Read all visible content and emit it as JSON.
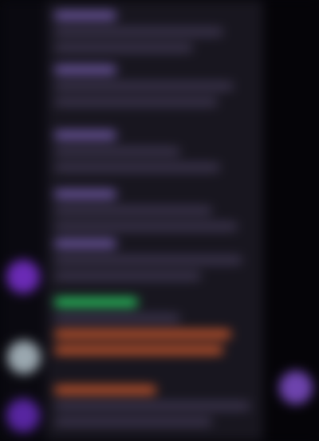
{
  "theme": {
    "background": "#06060a",
    "chat_surface": "#18161f",
    "name_color": "#6e58a2",
    "text_color": "#3e3650",
    "green_highlight": "#29d965",
    "orange_highlight": "#d45b2d",
    "avatar_purple": "#6a2ab5",
    "avatar_gray": "#9aa7af",
    "avatar_violet": "#5725a0",
    "right_bubble": "#6d43ad"
  },
  "chat": {
    "visible_text": ""
  },
  "icons": {
    "left_avatars": [
      "avatar-icon",
      "avatar-icon",
      "avatar-icon"
    ],
    "right_avatar": "avatar-icon"
  }
}
